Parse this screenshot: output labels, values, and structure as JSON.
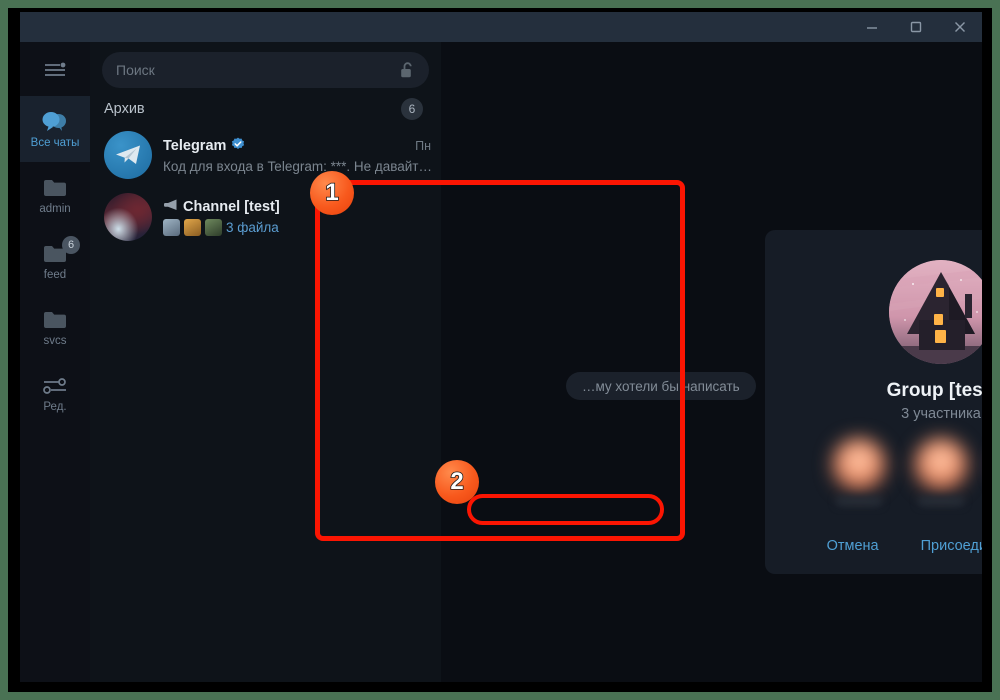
{
  "window": {
    "controls": [
      {
        "name": "minimize",
        "glyph": "minimize-icon"
      },
      {
        "name": "maximize",
        "glyph": "maximize-icon"
      },
      {
        "name": "close",
        "glyph": "close-icon"
      }
    ]
  },
  "rail": {
    "menu_icon": "hamburger-menu-icon",
    "folders": [
      {
        "label": "Все чаты",
        "icon": "chats-bubble-icon",
        "badge": "",
        "active": true
      },
      {
        "label": "admin",
        "icon": "folder-icon",
        "badge": "",
        "active": false
      },
      {
        "label": "feed",
        "icon": "folder-icon",
        "badge": "6",
        "active": false
      },
      {
        "label": "svcs",
        "icon": "folder-icon",
        "badge": "",
        "active": false
      },
      {
        "label": "Ред.",
        "icon": "sliders-icon",
        "badge": "",
        "active": false
      }
    ]
  },
  "search": {
    "placeholder": "Поиск",
    "value": "",
    "lock_icon": "unlocked-padlock-icon"
  },
  "archive": {
    "title": "Архив",
    "count": "6"
  },
  "chats": [
    {
      "name": "Telegram",
      "verified": true,
      "verified_icon": "verified-badge-icon",
      "time": "Пн",
      "preview": "Код для входа в Telegram: ***. Не давайт…",
      "avatar": "telegram-plane-icon"
    },
    {
      "name": "Channel [test]",
      "muted_icon": "muted-megaphone-icon",
      "time": "",
      "preview": "3 файла",
      "thumbs": 3,
      "avatar": "channel-photo"
    }
  ],
  "main": {
    "empty_pill": "…му хотели бы написать"
  },
  "modal": {
    "avatar_icon": "house-night-illustration",
    "title": "Group [test]",
    "subtitle": "3 участника",
    "members": [
      {
        "blur": true,
        "tone": "a"
      },
      {
        "blur": true,
        "tone": "b"
      },
      {
        "blur": true,
        "tone": "c"
      }
    ],
    "cancel_label": "Отмена",
    "join_label": "Присоединиться к группе"
  },
  "annotations": {
    "markers": [
      {
        "id": "1",
        "label": "1"
      },
      {
        "id": "2",
        "label": "2"
      }
    ],
    "highlight_color": "#fb1502",
    "marker_color": "#f8591d"
  },
  "colors": {
    "frame": "#4a7254",
    "titlebar": "#242f3d",
    "accent": "#4f9fd4",
    "modal_bg": "#161c26"
  }
}
